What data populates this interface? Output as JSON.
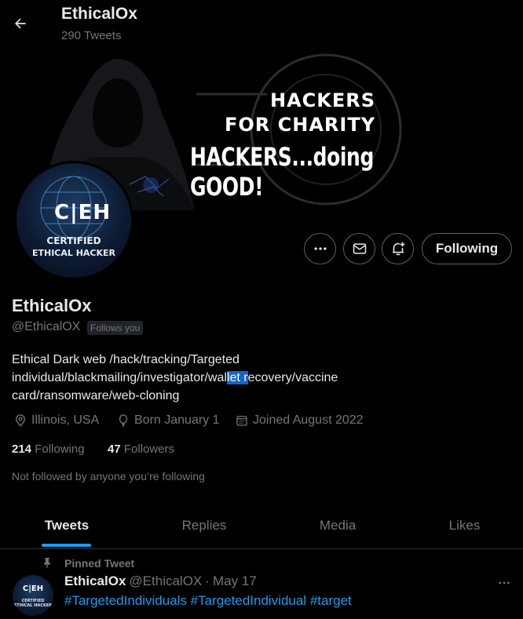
{
  "header": {
    "title": "EthicalOx",
    "tweet_count": "290 Tweets"
  },
  "banner": {
    "line1": "HACKERS",
    "line2": "FOR CHARITY",
    "line3": "HACKERS...doing  GOOD!"
  },
  "avatar": {
    "badge": "C|EH",
    "cert_line1": "CERTIFIED",
    "cert_line2": "ETHICAL HACKER"
  },
  "actions": {
    "following_label": "Following"
  },
  "profile": {
    "name": "EthicalOx",
    "handle": "@EthicalOX",
    "follows_you": "Follows you",
    "bio_line1": "Ethical Dark web /hack/tracking/Targeted",
    "bio_line2_pre": "individual/blackmailing/investigator/wal",
    "bio_line2_sel": "let r",
    "bio_line2_post": "ecovery/vaccine",
    "bio_line3": "card/ransomware/web-cloning",
    "location": "Illinois, USA",
    "born": "Born January 1",
    "joined": "Joined August 2022",
    "following_count": "214",
    "following_label": "Following",
    "followers_count": "47",
    "followers_label": "Followers",
    "not_followed": "Not followed by anyone you’re following"
  },
  "tabs": [
    {
      "label": "Tweets"
    },
    {
      "label": "Replies"
    },
    {
      "label": "Media"
    },
    {
      "label": "Likes"
    }
  ],
  "pinned_tweet": {
    "pinned_label": "Pinned Tweet",
    "name": "EthicalOx",
    "handle": "@EthicalOX",
    "sep": "·",
    "date": "May 17",
    "text": "#TargetedIndividuals #TargetedIndividual #target",
    "avatar_badge": "C|EH",
    "avatar_cert": "CERTIFIED ETHICAL HACKER"
  },
  "colors": {
    "accent": "#1d9bf0",
    "background": "#000000",
    "muted": "#71767b"
  }
}
